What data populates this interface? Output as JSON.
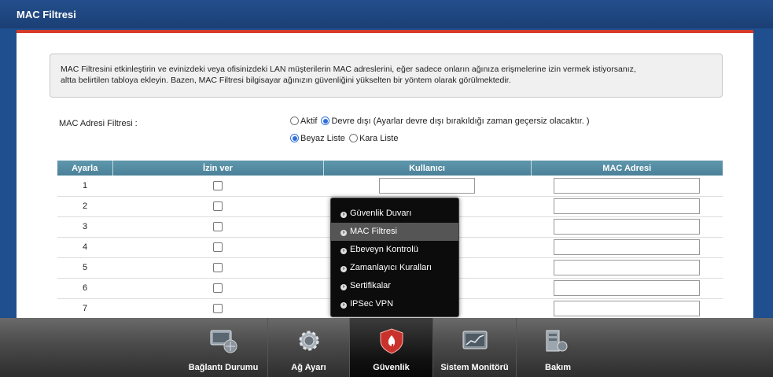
{
  "page_title": "MAC Filtresi",
  "info_text_line1": "MAC Filtresini etkinleştirin ve evinizdeki veya ofisinizdeki LAN müşterilerin MAC adreslerini, eğer sadece onların ağınıza erişmelerine izin vermek istiyorsanız,",
  "info_text_line2": "altta belirtilen tabloya ekleyin. Bazen, MAC Filtresi bilgisayar ağınızın güvenliğini yükselten bir yöntem olarak görülmektedir.",
  "filter": {
    "label": "MAC Adresi Filtresi :",
    "active_label": "Aktif",
    "disabled_label": "Devre dışı (Ayarlar devre dışı bırakıldığı zaman geçersiz olacaktır. )",
    "selected_mode": "Devre dışı",
    "whitelist_label": "Beyaz Liste",
    "blacklist_label": "Kara Liste",
    "selected_list": "Beyaz Liste"
  },
  "table": {
    "headers": [
      "Ayarla",
      "İzin ver",
      "Kullanıcı",
      "MAC Adresi"
    ],
    "rows": [
      "1",
      "2",
      "3",
      "4",
      "5",
      "6",
      "7"
    ]
  },
  "popup_menu": {
    "items": [
      "Güvenlik Duvarı",
      "MAC Filtresi",
      "Ebeveyn Kontrolü",
      "Zamanlayıcı Kuralları",
      "Sertifikalar",
      "IPSec VPN"
    ],
    "active": "MAC Filtresi"
  },
  "taskbar": {
    "buttons": [
      "Bağlantı Durumu",
      "Ağ Ayarı",
      "Güvenlik",
      "Sistem Monitörü",
      "Bakım"
    ],
    "active": "Güvenlik"
  },
  "colors": {
    "header_blue": "#1f4f8e",
    "accent_red": "#d53a2b",
    "table_header": "#5590a7"
  }
}
